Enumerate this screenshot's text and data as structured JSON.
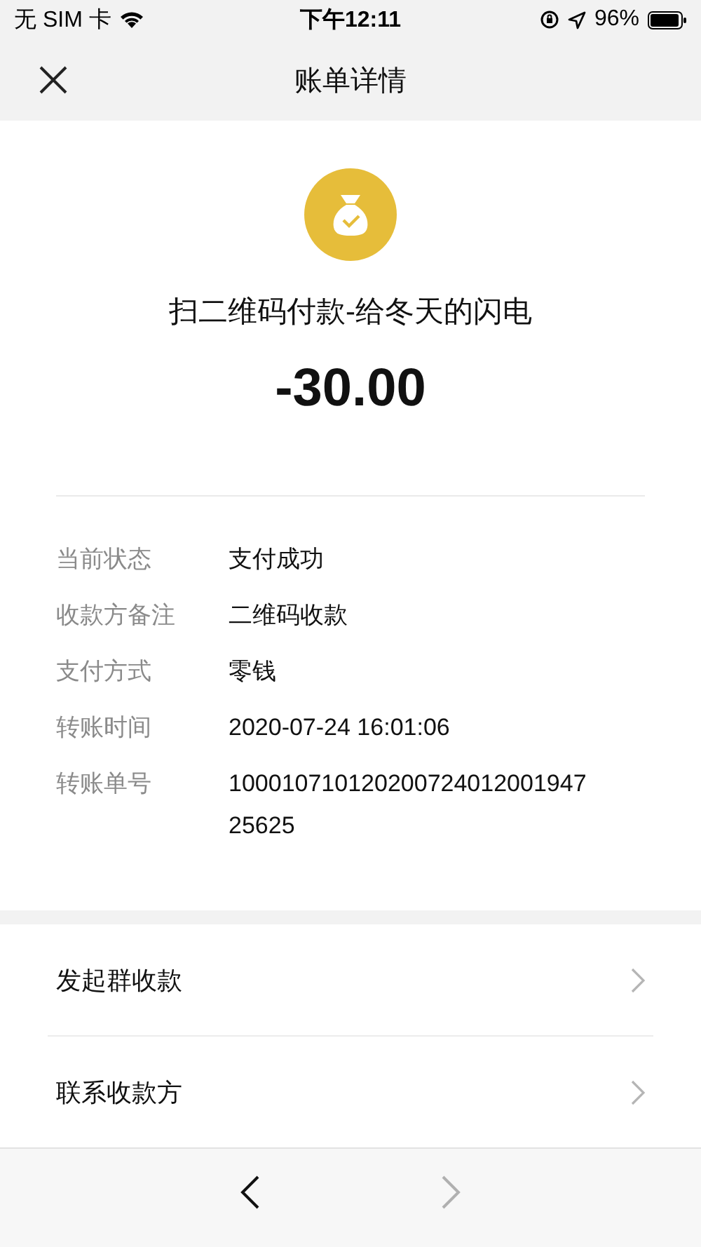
{
  "status_bar": {
    "carrier": "无 SIM 卡",
    "time": "下午12:11",
    "battery": "96%"
  },
  "nav_bar": {
    "title": "账单详情"
  },
  "summary": {
    "title": "扫二维码付款-给冬天的闪电",
    "amount": "-30.00"
  },
  "details": [
    {
      "label": "当前状态",
      "value": "支付成功"
    },
    {
      "label": "收款方备注",
      "value": "二维码收款"
    },
    {
      "label": "支付方式",
      "value": "零钱"
    },
    {
      "label": "转账时间",
      "value": "2020-07-24 16:01:06"
    },
    {
      "label": "转账单号",
      "value": "10001071012020072401200194725625"
    }
  ],
  "actions": [
    {
      "label": "发起群收款"
    },
    {
      "label": "联系收款方"
    }
  ],
  "toolbar": {
    "back_disabled": false,
    "forward_disabled": true
  }
}
